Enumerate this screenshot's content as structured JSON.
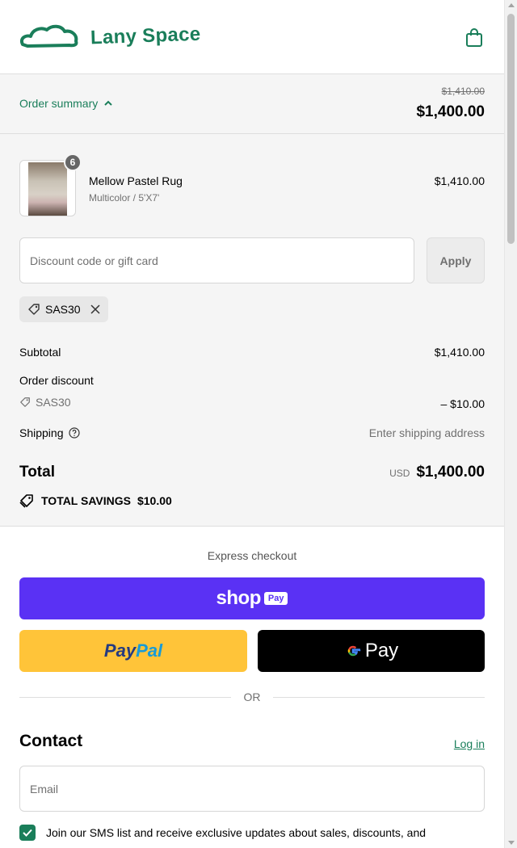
{
  "brand": {
    "name": "Lany Space",
    "color": "#1a7e5a"
  },
  "header": {
    "cart_icon": "shopping-bag-icon"
  },
  "summary_bar": {
    "toggle_label": "Order summary",
    "original_total": "$1,410.00",
    "total": "$1,400.00"
  },
  "product": {
    "quantity": "6",
    "name": "Mellow Pastel Rug",
    "variant": "Multicolor / 5'X7'",
    "price": "$1,410.00"
  },
  "discount": {
    "placeholder": "Discount code or gift card",
    "apply_label": "Apply",
    "applied_code": "SAS30"
  },
  "lines": {
    "subtotal_label": "Subtotal",
    "subtotal_value": "$1,410.00",
    "order_discount_label": "Order discount",
    "discount_code": "SAS30",
    "discount_value": "– $10.00",
    "shipping_label": "Shipping",
    "shipping_value": "Enter shipping address"
  },
  "total": {
    "label": "Total",
    "currency": "USD",
    "amount": "$1,400.00",
    "savings_label": "TOTAL SAVINGS",
    "savings_amount": "$10.00"
  },
  "express": {
    "title": "Express checkout",
    "shop_word": "shop",
    "shop_pay_chip": "Pay",
    "shop_color": "#5a31f4",
    "paypal_a": "Pay",
    "paypal_b": "Pal",
    "paypal_color": "#ffc439",
    "gpay_label": "Pay",
    "or_label": "OR"
  },
  "contact": {
    "title": "Contact",
    "login_label": "Log in",
    "email_placeholder": "Email",
    "sms_checked": true,
    "sms_text": "Join our SMS list and receive exclusive updates about sales, discounts, and"
  }
}
